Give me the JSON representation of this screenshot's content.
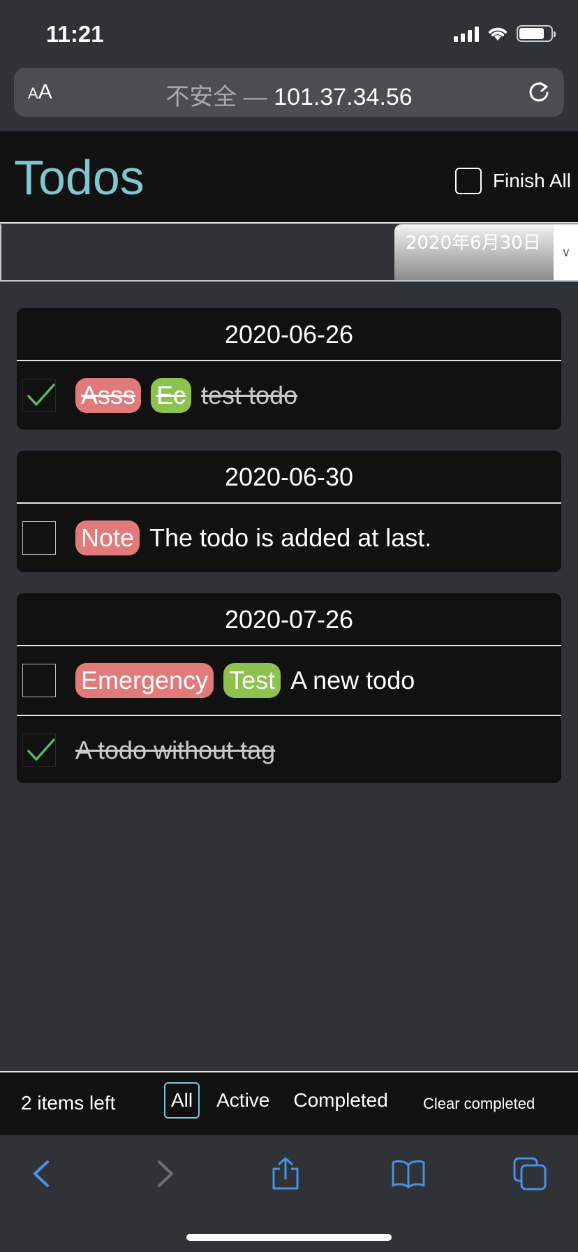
{
  "status_bar": {
    "time": "11:21"
  },
  "address_bar": {
    "aa_label": "AA",
    "insecure_label": "不安全 —",
    "host": "101.37.34.56"
  },
  "header": {
    "title": "Todos",
    "finish_all_label": "Finish All"
  },
  "new_todo": {
    "input_value": "",
    "date_value": "2020年6月30日",
    "date_arrow": "∨"
  },
  "groups": [
    {
      "date": "2020-06-26",
      "todos": [
        {
          "completed": true,
          "tags": [
            {
              "label": "Asss",
              "color": "#e17b7b"
            },
            {
              "label": "Ec",
              "color": "#8dc24e"
            }
          ],
          "text": "test todo"
        }
      ]
    },
    {
      "date": "2020-06-30",
      "todos": [
        {
          "completed": false,
          "tags": [
            {
              "label": "Note",
              "color": "#e17b7b"
            }
          ],
          "text": "The todo is added at last."
        }
      ]
    },
    {
      "date": "2020-07-26",
      "todos": [
        {
          "completed": false,
          "tags": [
            {
              "label": "Emergency",
              "color": "#e17b7b"
            },
            {
              "label": "Test",
              "color": "#8dc24e"
            }
          ],
          "text": "A new todo"
        },
        {
          "completed": true,
          "tags": [],
          "text": "A todo without tag"
        }
      ]
    }
  ],
  "footer": {
    "items_left": "2 items left",
    "filters": [
      "All",
      "Active",
      "Completed"
    ],
    "selected_filter": "All",
    "clear_completed": "Clear completed"
  },
  "colors": {
    "accent": "#7fc7d1",
    "tag_red": "#e17b7b",
    "tag_green": "#8dc24e",
    "check_green": "#5cb85c",
    "browser_blue": "#4a90e2"
  },
  "toolbar_icons": [
    "back-icon",
    "forward-icon",
    "share-icon",
    "bookmarks-icon",
    "tabs-icon"
  ]
}
